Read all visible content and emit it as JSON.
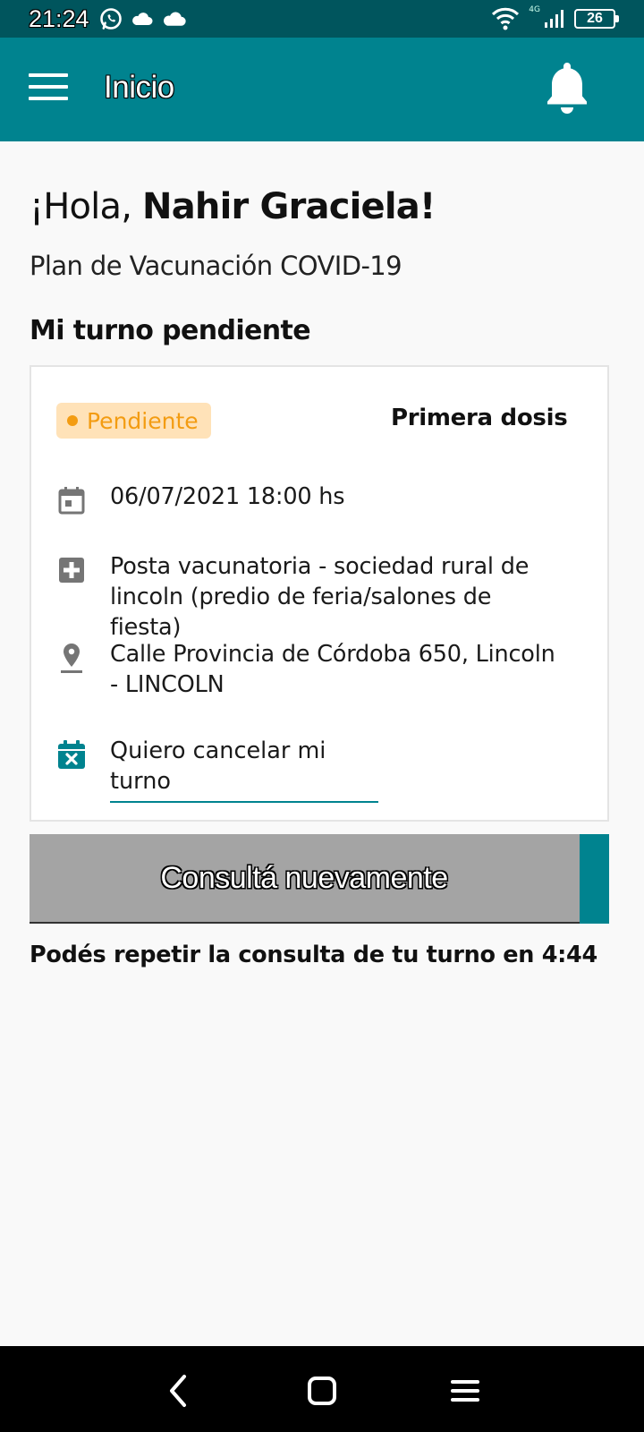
{
  "status_bar": {
    "time": "21:24",
    "network": "4G",
    "battery": "26",
    "icons": [
      "whatsapp-icon",
      "cloud-icon",
      "cloud-icon",
      "wifi-icon",
      "signal-icon",
      "battery-icon"
    ]
  },
  "app_bar": {
    "title": "Inicio",
    "menu_icon": "hamburger-menu-icon",
    "bell_icon": "bell-icon"
  },
  "greeting": {
    "prefix": "¡Hola, ",
    "name": "Nahir Graciela!"
  },
  "subtitle": "Plan de Vacunación COVID-19",
  "section_title": "Mi turno pendiente",
  "appointment": {
    "status": "Pendiente",
    "dose": "Primera dosis",
    "datetime": "06/07/2021 18:00 hs",
    "place": "Posta vacunatoria - sociedad rural de lincoln (predio de feria/salones de fiesta)",
    "address": "Calle Provincia de Córdoba 650, Lincoln - LINCOLN",
    "cancel_label": "Quiero cancelar mi turno"
  },
  "query_button": {
    "label": "Consultá nuevamente"
  },
  "retry_text": "Podés repetir la consulta de tu turno en 4:44",
  "colors": {
    "primary": "#00838f",
    "status_bar": "#00555d",
    "pending_bg": "#ffe2b8",
    "pending_fg": "#f39c12",
    "button_disabled": "#a4a4a4"
  }
}
